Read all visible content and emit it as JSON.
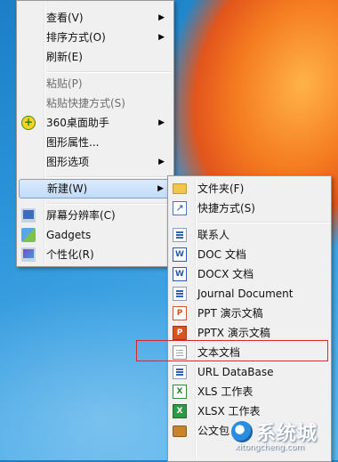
{
  "main_menu": {
    "view": "查看(V)",
    "sort": "排序方式(O)",
    "refresh": "刷新(E)",
    "paste": "粘贴(P)",
    "paste_shortcut": "粘贴快捷方式(S)",
    "helper_360": "360桌面助手",
    "graphics_properties": "图形属性...",
    "graphics_options": "图形选项",
    "new": "新建(W)",
    "screen_resolution": "屏幕分辨率(C)",
    "gadgets": "Gadgets",
    "personalize": "个性化(R)"
  },
  "sub_menu": {
    "folder": "文件夹(F)",
    "shortcut": "快捷方式(S)",
    "contact": "联系人",
    "doc": "DOC 文档",
    "docx": "DOCX 文档",
    "journal": "Journal Document",
    "ppt": "PPT 演示文稿",
    "pptx": "PPTX 演示文稿",
    "text_doc": "文本文档",
    "url_db": "URL DataBase",
    "xls": "XLS 工作表",
    "xlsx": "XLSX 工作表",
    "briefcase": "公文包"
  },
  "watermark": {
    "name": "系统城",
    "url": "xitongcheng.com"
  },
  "colors": {
    "highlight_outline": "#d7282a",
    "hover_fill": "#c1dbfc",
    "desktop_blue": "#2a93d8"
  },
  "icons": {
    "helper_360": "360-icon",
    "screen_resolution": "monitor-icon",
    "gadgets": "gadgets-icon",
    "personalize": "personalize-icon",
    "folder": "folder-icon",
    "shortcut": "shortcut-icon",
    "contact": "contact-icon",
    "doc": "doc-icon",
    "docx": "word-icon",
    "journal": "journal-icon",
    "ppt": "ppt-icon",
    "pptx": "pptx-icon",
    "text_doc": "text-file-icon",
    "url_db": "database-icon",
    "xls": "xls-icon",
    "xlsx": "xlsx-icon",
    "briefcase": "briefcase-icon"
  }
}
